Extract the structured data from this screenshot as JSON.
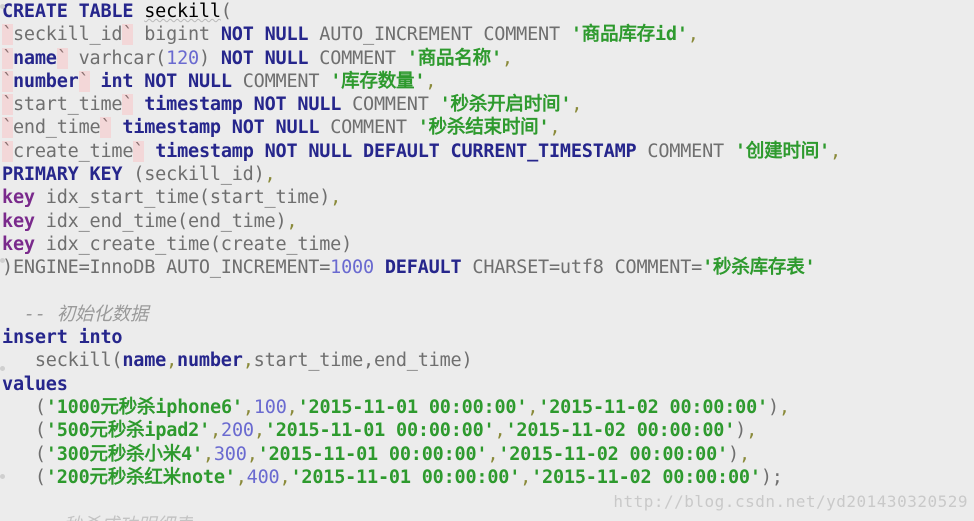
{
  "meta": {
    "background_color": "#ececec",
    "colors": {
      "keyword": "#26268c",
      "keyword_alt": "#7a2a8c",
      "plain": "#6f6f6f",
      "string": "#2e9a2e",
      "number": "#6a6ad0",
      "punctuation": "#8a8a3a",
      "comment": "#9a9a9a",
      "backtick_highlight": "#f3d7d8",
      "watermark": "#c9c9c9"
    }
  },
  "code": {
    "lines": [
      {
        "id": "line-create-table",
        "tokens": [
          {
            "t": "kw",
            "v": "CREATE TABLE"
          },
          {
            "t": "plain",
            "v": " "
          },
          {
            "t": "spell",
            "v": "seckill"
          },
          {
            "t": "plain",
            "v": "("
          }
        ]
      },
      {
        "id": "line-col-seckill-id",
        "tokens": [
          {
            "t": "tick",
            "v": "`"
          },
          {
            "t": "plain",
            "v": "seckill_id"
          },
          {
            "t": "tick",
            "v": "`"
          },
          {
            "t": "plain",
            "v": " bigint "
          },
          {
            "t": "kw",
            "v": "NOT NULL"
          },
          {
            "t": "plain",
            "v": " AUTO_INCREMENT COMMENT "
          },
          {
            "t": "str",
            "v": "'商品库存id'"
          },
          {
            "t": "punc",
            "v": ","
          }
        ]
      },
      {
        "id": "line-col-name",
        "tokens": [
          {
            "t": "tick",
            "v": "`"
          },
          {
            "t": "kw",
            "v": "name"
          },
          {
            "t": "tick",
            "v": "`"
          },
          {
            "t": "plain",
            "v": " varhcar("
          },
          {
            "t": "num",
            "v": "120"
          },
          {
            "t": "plain",
            "v": ") "
          },
          {
            "t": "kw",
            "v": "NOT NULL"
          },
          {
            "t": "plain",
            "v": " COMMENT "
          },
          {
            "t": "str",
            "v": "'商品名称'"
          },
          {
            "t": "punc",
            "v": ","
          }
        ]
      },
      {
        "id": "line-col-number",
        "tokens": [
          {
            "t": "tick",
            "v": "`"
          },
          {
            "t": "kw",
            "v": "number"
          },
          {
            "t": "tick",
            "v": "`"
          },
          {
            "t": "plain",
            "v": " "
          },
          {
            "t": "kw",
            "v": "int NOT NULL"
          },
          {
            "t": "plain",
            "v": " COMMENT "
          },
          {
            "t": "str",
            "v": "'库存数量'"
          },
          {
            "t": "punc",
            "v": ","
          }
        ]
      },
      {
        "id": "line-col-start-time",
        "tokens": [
          {
            "t": "tick",
            "v": "`"
          },
          {
            "t": "plain",
            "v": "start_time"
          },
          {
            "t": "tick",
            "v": "`"
          },
          {
            "t": "plain",
            "v": " "
          },
          {
            "t": "kw",
            "v": "timestamp NOT NULL"
          },
          {
            "t": "plain",
            "v": " COMMENT "
          },
          {
            "t": "str",
            "v": "'秒杀开启时间'"
          },
          {
            "t": "punc",
            "v": ","
          }
        ]
      },
      {
        "id": "line-col-end-time",
        "tokens": [
          {
            "t": "tick",
            "v": "`"
          },
          {
            "t": "plain",
            "v": "end_time"
          },
          {
            "t": "tick",
            "v": "`"
          },
          {
            "t": "plain",
            "v": " "
          },
          {
            "t": "kw",
            "v": "timestamp NOT NULL"
          },
          {
            "t": "plain",
            "v": " COMMENT "
          },
          {
            "t": "str",
            "v": "'秒杀结束时间'"
          },
          {
            "t": "punc",
            "v": ","
          }
        ]
      },
      {
        "id": "line-col-create-time",
        "tokens": [
          {
            "t": "tick",
            "v": "`"
          },
          {
            "t": "plain",
            "v": "create_time"
          },
          {
            "t": "tick",
            "v": "`"
          },
          {
            "t": "plain",
            "v": " "
          },
          {
            "t": "kw",
            "v": "timestamp NOT NULL DEFAULT CURRENT_TIMESTAMP"
          },
          {
            "t": "plain",
            "v": " COMMENT "
          },
          {
            "t": "str",
            "v": "'创建时间'"
          },
          {
            "t": "punc",
            "v": ","
          }
        ]
      },
      {
        "id": "line-primary-key",
        "tokens": [
          {
            "t": "kw",
            "v": "PRIMARY KEY"
          },
          {
            "t": "plain",
            "v": " (seckill_id)"
          },
          {
            "t": "punc",
            "v": ","
          }
        ]
      },
      {
        "id": "line-key-idx-start-time",
        "tokens": [
          {
            "t": "kw2",
            "v": "key"
          },
          {
            "t": "plain",
            "v": " idx_start_time(start_time)"
          },
          {
            "t": "punc",
            "v": ","
          }
        ]
      },
      {
        "id": "line-key-idx-end-time",
        "tokens": [
          {
            "t": "kw2",
            "v": "key"
          },
          {
            "t": "plain",
            "v": " idx_end_time(end_time)"
          },
          {
            "t": "punc",
            "v": ","
          }
        ]
      },
      {
        "id": "line-key-idx-create-time",
        "tokens": [
          {
            "t": "kw2",
            "v": "key"
          },
          {
            "t": "plain",
            "v": " idx_create_time(create_time)"
          }
        ]
      },
      {
        "id": "line-engine",
        "tokens": [
          {
            "t": "plain",
            "v": ")ENGINE=InnoDB AUTO_INCREMENT="
          },
          {
            "t": "num",
            "v": "1000"
          },
          {
            "t": "plain",
            "v": " "
          },
          {
            "t": "kw",
            "v": "DEFAULT"
          },
          {
            "t": "plain",
            "v": " CHARSET=utf8 COMMENT="
          },
          {
            "t": "str",
            "v": "'秒杀库存表'"
          }
        ]
      },
      {
        "id": "line-blank-1",
        "tokens": []
      },
      {
        "id": "line-comment-init",
        "tokens": [
          {
            "t": "plain",
            "v": "  "
          },
          {
            "t": "cmt",
            "v": "-- 初始化数据"
          }
        ]
      },
      {
        "id": "line-insert-into",
        "tokens": [
          {
            "t": "kw",
            "v": "insert into"
          }
        ]
      },
      {
        "id": "line-insert-columns",
        "tokens": [
          {
            "t": "plain",
            "v": "   seckill("
          },
          {
            "t": "kw",
            "v": "name"
          },
          {
            "t": "punc",
            "v": ","
          },
          {
            "t": "kw",
            "v": "number"
          },
          {
            "t": "punc",
            "v": ","
          },
          {
            "t": "plain",
            "v": "start_time,end_time)"
          }
        ]
      },
      {
        "id": "line-values-keyword",
        "tokens": [
          {
            "t": "kw",
            "v": "values"
          }
        ]
      },
      {
        "id": "line-values-row-1",
        "tokens": [
          {
            "t": "plain",
            "v": "   ("
          },
          {
            "t": "str",
            "v": "'1000元秒杀iphone6'"
          },
          {
            "t": "punc",
            "v": ","
          },
          {
            "t": "num",
            "v": "100"
          },
          {
            "t": "punc",
            "v": ","
          },
          {
            "t": "str",
            "v": "'2015-11-01 00:00:00'"
          },
          {
            "t": "punc",
            "v": ","
          },
          {
            "t": "str",
            "v": "'2015-11-02 00:00:00'"
          },
          {
            "t": "plain",
            "v": ")"
          },
          {
            "t": "punc",
            "v": ","
          }
        ]
      },
      {
        "id": "line-values-row-2",
        "tokens": [
          {
            "t": "plain",
            "v": "   ("
          },
          {
            "t": "str",
            "v": "'500元秒杀ipad2'"
          },
          {
            "t": "punc",
            "v": ","
          },
          {
            "t": "num",
            "v": "200"
          },
          {
            "t": "punc",
            "v": ","
          },
          {
            "t": "str",
            "v": "'2015-11-01 00:00:00'"
          },
          {
            "t": "punc",
            "v": ","
          },
          {
            "t": "str",
            "v": "'2015-11-02 00:00:00'"
          },
          {
            "t": "plain",
            "v": ")"
          },
          {
            "t": "punc",
            "v": ","
          }
        ]
      },
      {
        "id": "line-values-row-3",
        "tokens": [
          {
            "t": "plain",
            "v": "   ("
          },
          {
            "t": "str",
            "v": "'300元秒杀小米4'"
          },
          {
            "t": "punc",
            "v": ","
          },
          {
            "t": "num",
            "v": "300"
          },
          {
            "t": "punc",
            "v": ","
          },
          {
            "t": "str",
            "v": "'2015-11-01 00:00:00'"
          },
          {
            "t": "punc",
            "v": ","
          },
          {
            "t": "str",
            "v": "'2015-11-02 00:00:00'"
          },
          {
            "t": "plain",
            "v": ")"
          },
          {
            "t": "punc",
            "v": ","
          }
        ]
      },
      {
        "id": "line-values-row-4",
        "tokens": [
          {
            "t": "plain",
            "v": "   ("
          },
          {
            "t": "str",
            "v": "'200元秒杀红米note'"
          },
          {
            "t": "punc",
            "v": ","
          },
          {
            "t": "num",
            "v": "400"
          },
          {
            "t": "punc",
            "v": ","
          },
          {
            "t": "str",
            "v": "'2015-11-01 00:00:00'"
          },
          {
            "t": "punc",
            "v": ","
          },
          {
            "t": "str",
            "v": "'2015-11-02 00:00:00'"
          },
          {
            "t": "plain",
            "v": ");"
          }
        ]
      }
    ]
  },
  "cutoff_line": {
    "text": "-- 秒杀成功明细表"
  },
  "watermark": {
    "text": "http://blog.csdn.net/yd201430320529"
  },
  "fold_markers": {
    "tops": [
      4,
      258,
      366,
      474
    ]
  }
}
